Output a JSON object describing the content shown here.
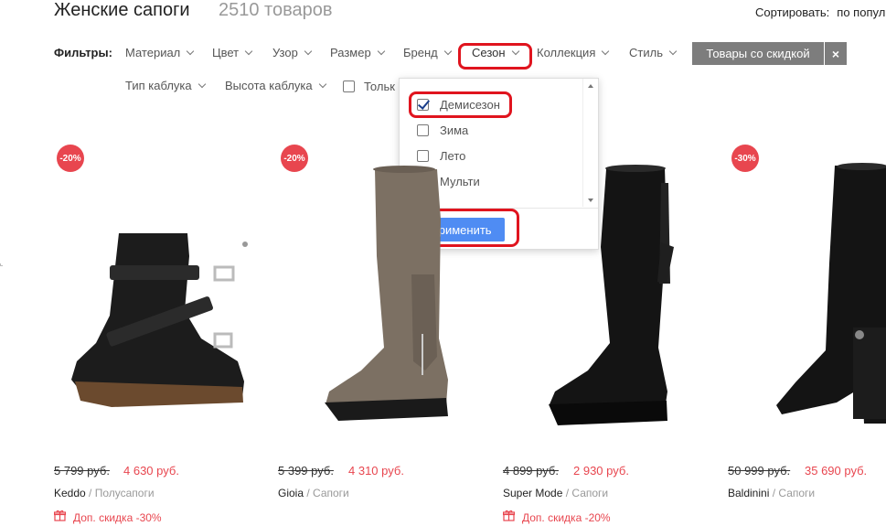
{
  "header": {
    "title": "Женские сапоги",
    "count": "2510 товаров",
    "sort_label": "Сортировать:",
    "sort_value": "по попул"
  },
  "filters": {
    "label": "Фильтры:",
    "row1": [
      "Материал",
      "Цвет",
      "Узор",
      "Размер",
      "Бренд",
      "Сезон",
      "Коллекция",
      "Стиль"
    ],
    "row2": [
      "Тип каблука",
      "Высота каблука"
    ],
    "only_label": "Тольк",
    "discount_button": "Товары со скидкой",
    "discount_close": "×"
  },
  "season_dropdown": {
    "options": [
      {
        "label": "Демисезон",
        "checked": true
      },
      {
        "label": "Зима",
        "checked": false
      },
      {
        "label": "Лето",
        "checked": false
      },
      {
        "label": "Мульти",
        "checked": false
      }
    ],
    "apply_label": "Применить"
  },
  "products": [
    {
      "badge": "-20%",
      "old_price": "5 799 руб.",
      "new_price": "4 630 руб.",
      "brand": "Keddo",
      "category": "Полусапоги",
      "promo": "Доп. скидка -30%"
    },
    {
      "badge": "-20%",
      "old_price": "5 399 руб.",
      "new_price": "4 310 руб.",
      "brand": "Gioia",
      "category": "Сапоги",
      "promo": ""
    },
    {
      "badge": "",
      "old_price": "4 899 руб.",
      "new_price": "2 930 руб.",
      "brand": "Super Mode",
      "category": "Сапоги",
      "promo": "Доп. скидка -20%"
    },
    {
      "badge": "-30%",
      "old_price": "50 999 руб.",
      "new_price": "35 690 руб.",
      "brand": "Baldinini",
      "category": "Сапоги",
      "promo": ""
    }
  ],
  "colors": {
    "accent_red": "#e8464f",
    "highlight_red": "#e0141e",
    "apply_blue": "#4f8cf3",
    "discount_gray": "#7d7d7d"
  }
}
